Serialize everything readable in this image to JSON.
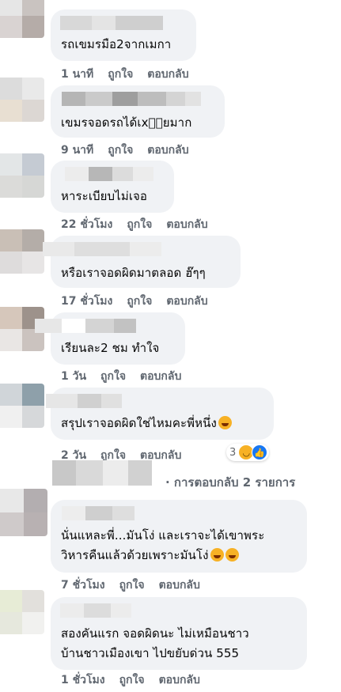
{
  "comments": [
    {
      "text": "รถเขมรมือ2จากเมกา",
      "time": "1 นาที",
      "like": "ถูกใจ",
      "reply": "ตอบกลับ"
    },
    {
      "text": "เขมรจอดรถได้เx􀀀􀀀ยมาก",
      "time": "9 นาที",
      "like": "ถูกใจ",
      "reply": "ตอบกลับ"
    },
    {
      "text": "หาระเบียบไม่เจอ",
      "time": "22 ชั่วโมง",
      "like": "ถูกใจ",
      "reply": "ตอบกลับ"
    },
    {
      "text": "หรือเราจอดผิดมาตลอด ฮ๊ๆๆ",
      "time": "17 ชั่วโมง",
      "like": "ถูกใจ",
      "reply": "ตอบกลับ"
    },
    {
      "text": "เรียนละ2 ชม ทำใจ",
      "time": "1 วัน",
      "like": "ถูกใจ",
      "reply": "ตอบกลับ"
    },
    {
      "text": "สรุปเราจอดผิดใช่ไหมคะพี่หนึ่ง",
      "time": "2 วัน",
      "like": "ถูกใจ",
      "reply": "ตอบกลับ",
      "reaction_count": "3"
    },
    {
      "text_line1": "นั่นแหละพี่...มันโง่ และเราจะได้เขาพระ",
      "text_line2": "วิหารคืนแล้วด้วยเพราะมันโง่",
      "time": "7 ชั่วโมง",
      "like": "ถูกใจ",
      "reply": "ตอบกลับ"
    },
    {
      "text_line1": "สองคันแรก จอดผิดนะ ไม่เหมือนชาว",
      "text_line2": "บ้านชาวเมืองเขา ไปขยับด่วน 555",
      "time": "1 ชั่วโมง",
      "like": "ถูกใจ",
      "reply": "ตอบกลับ"
    }
  ],
  "replies_link": "· การตอบกลับ 2 รายการ",
  "colors": {
    "bubble": "#f0f2f5",
    "meta": "#606770",
    "text": "#050505",
    "like_blue": "#1877f2",
    "haha_yellow": "#f7b125"
  },
  "icons": [
    "haha-emoji-icon",
    "like-reaction-icon",
    "haha-reaction-icon"
  ]
}
